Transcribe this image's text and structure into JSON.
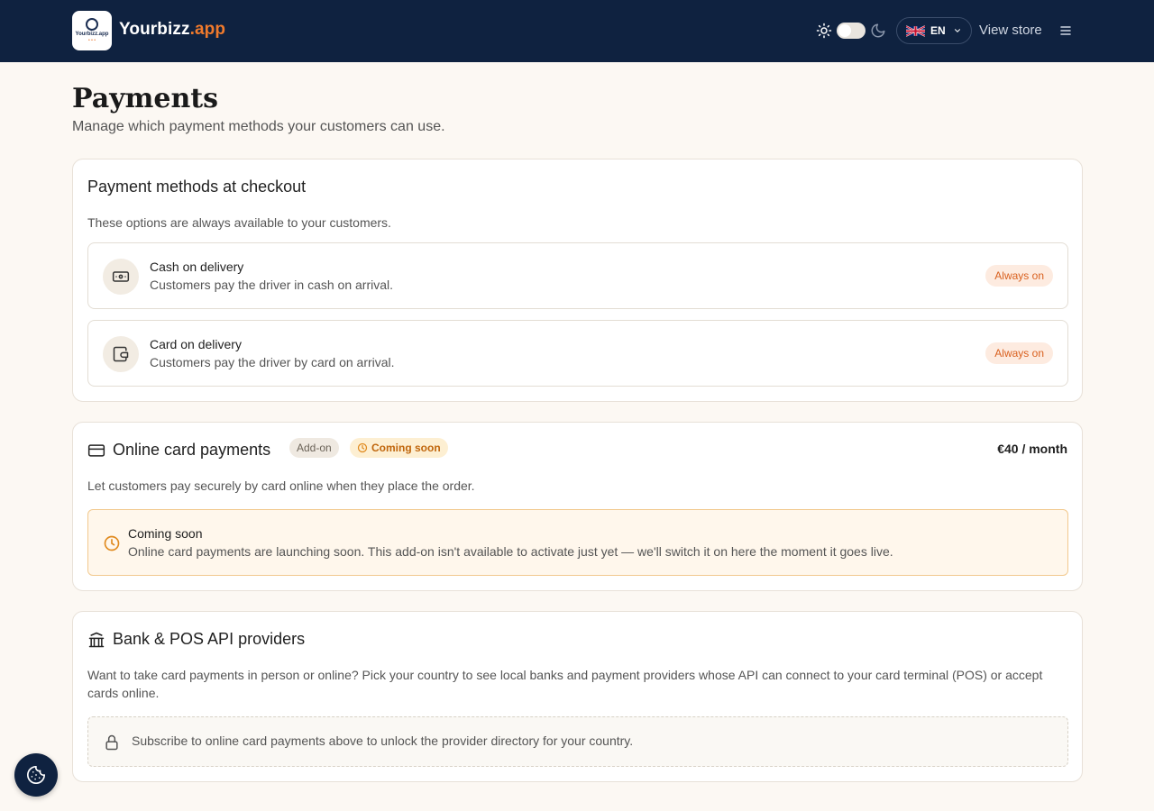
{
  "header": {
    "logo_text": "Yourbizz.app",
    "brand_name": "Yourbizz",
    "brand_suffix": ".app",
    "theme_icons": [
      "sun-icon",
      "moon-icon"
    ],
    "language": {
      "flag": "uk-flag-icon",
      "code": "EN"
    },
    "view_store_label": "View store",
    "menu_icon": "hamburger-menu-icon"
  },
  "page": {
    "title": "Payments",
    "subtitle": "Manage which payment methods your customers can use."
  },
  "checkout_methods": {
    "title": "Payment methods at checkout",
    "description": "These options are always available to your customers.",
    "items": [
      {
        "icon": "banknote-icon",
        "title": "Cash on delivery",
        "description": "Customers pay the driver in cash on arrival.",
        "badge": "Always on"
      },
      {
        "icon": "wallet-icon",
        "title": "Card on delivery",
        "description": "Customers pay the driver by card on arrival.",
        "badge": "Always on"
      }
    ]
  },
  "online_card": {
    "title": "Online card payments",
    "addon_badge": "Add-on",
    "soon_badge": "Coming soon",
    "price": "€40 / month",
    "description": "Let customers pay securely by card online when they place the order.",
    "notice": {
      "title": "Coming soon",
      "text": "Online card payments are launching soon. This add-on isn't available to activate just yet — we'll switch it on here the moment it goes live."
    }
  },
  "bank_providers": {
    "title": "Bank & POS API providers",
    "description": "Want to take card payments in person or online? Pick your country to see local banks and payment providers whose API can connect to your card terminal (POS) or accept cards online.",
    "locked_text": "Subscribe to online card payments above to unlock the provider directory for your country."
  },
  "colors": {
    "header_bg": "#0f2240",
    "accent": "#f07a2c",
    "page_bg": "#fcf8f3",
    "warning": "#c0660c"
  }
}
